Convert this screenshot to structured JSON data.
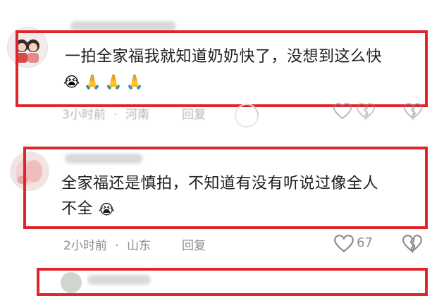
{
  "comments": [
    {
      "text": "一拍全家福我就知道奶奶快了，没想到这么快",
      "emojis": [
        "😭",
        "🙏",
        "🙏",
        "🙏"
      ],
      "time": "3小时前",
      "location": "河南",
      "reply_label": "回复"
    },
    {
      "text_line1": "全家福还是慎拍，不知道有没有听说过像全人",
      "text_line2": "不全",
      "emojis": [
        "😭"
      ],
      "time": "2小时前",
      "location": "山东",
      "reply_label": "回复",
      "like_count": "67"
    }
  ],
  "meta_separator": "·",
  "colors": {
    "highlight_border": "#e0242b",
    "meta_text": "#8c8c8c"
  },
  "icons": [
    "heart-icon",
    "broken-heart-icon",
    "loading-spinner-icon"
  ]
}
